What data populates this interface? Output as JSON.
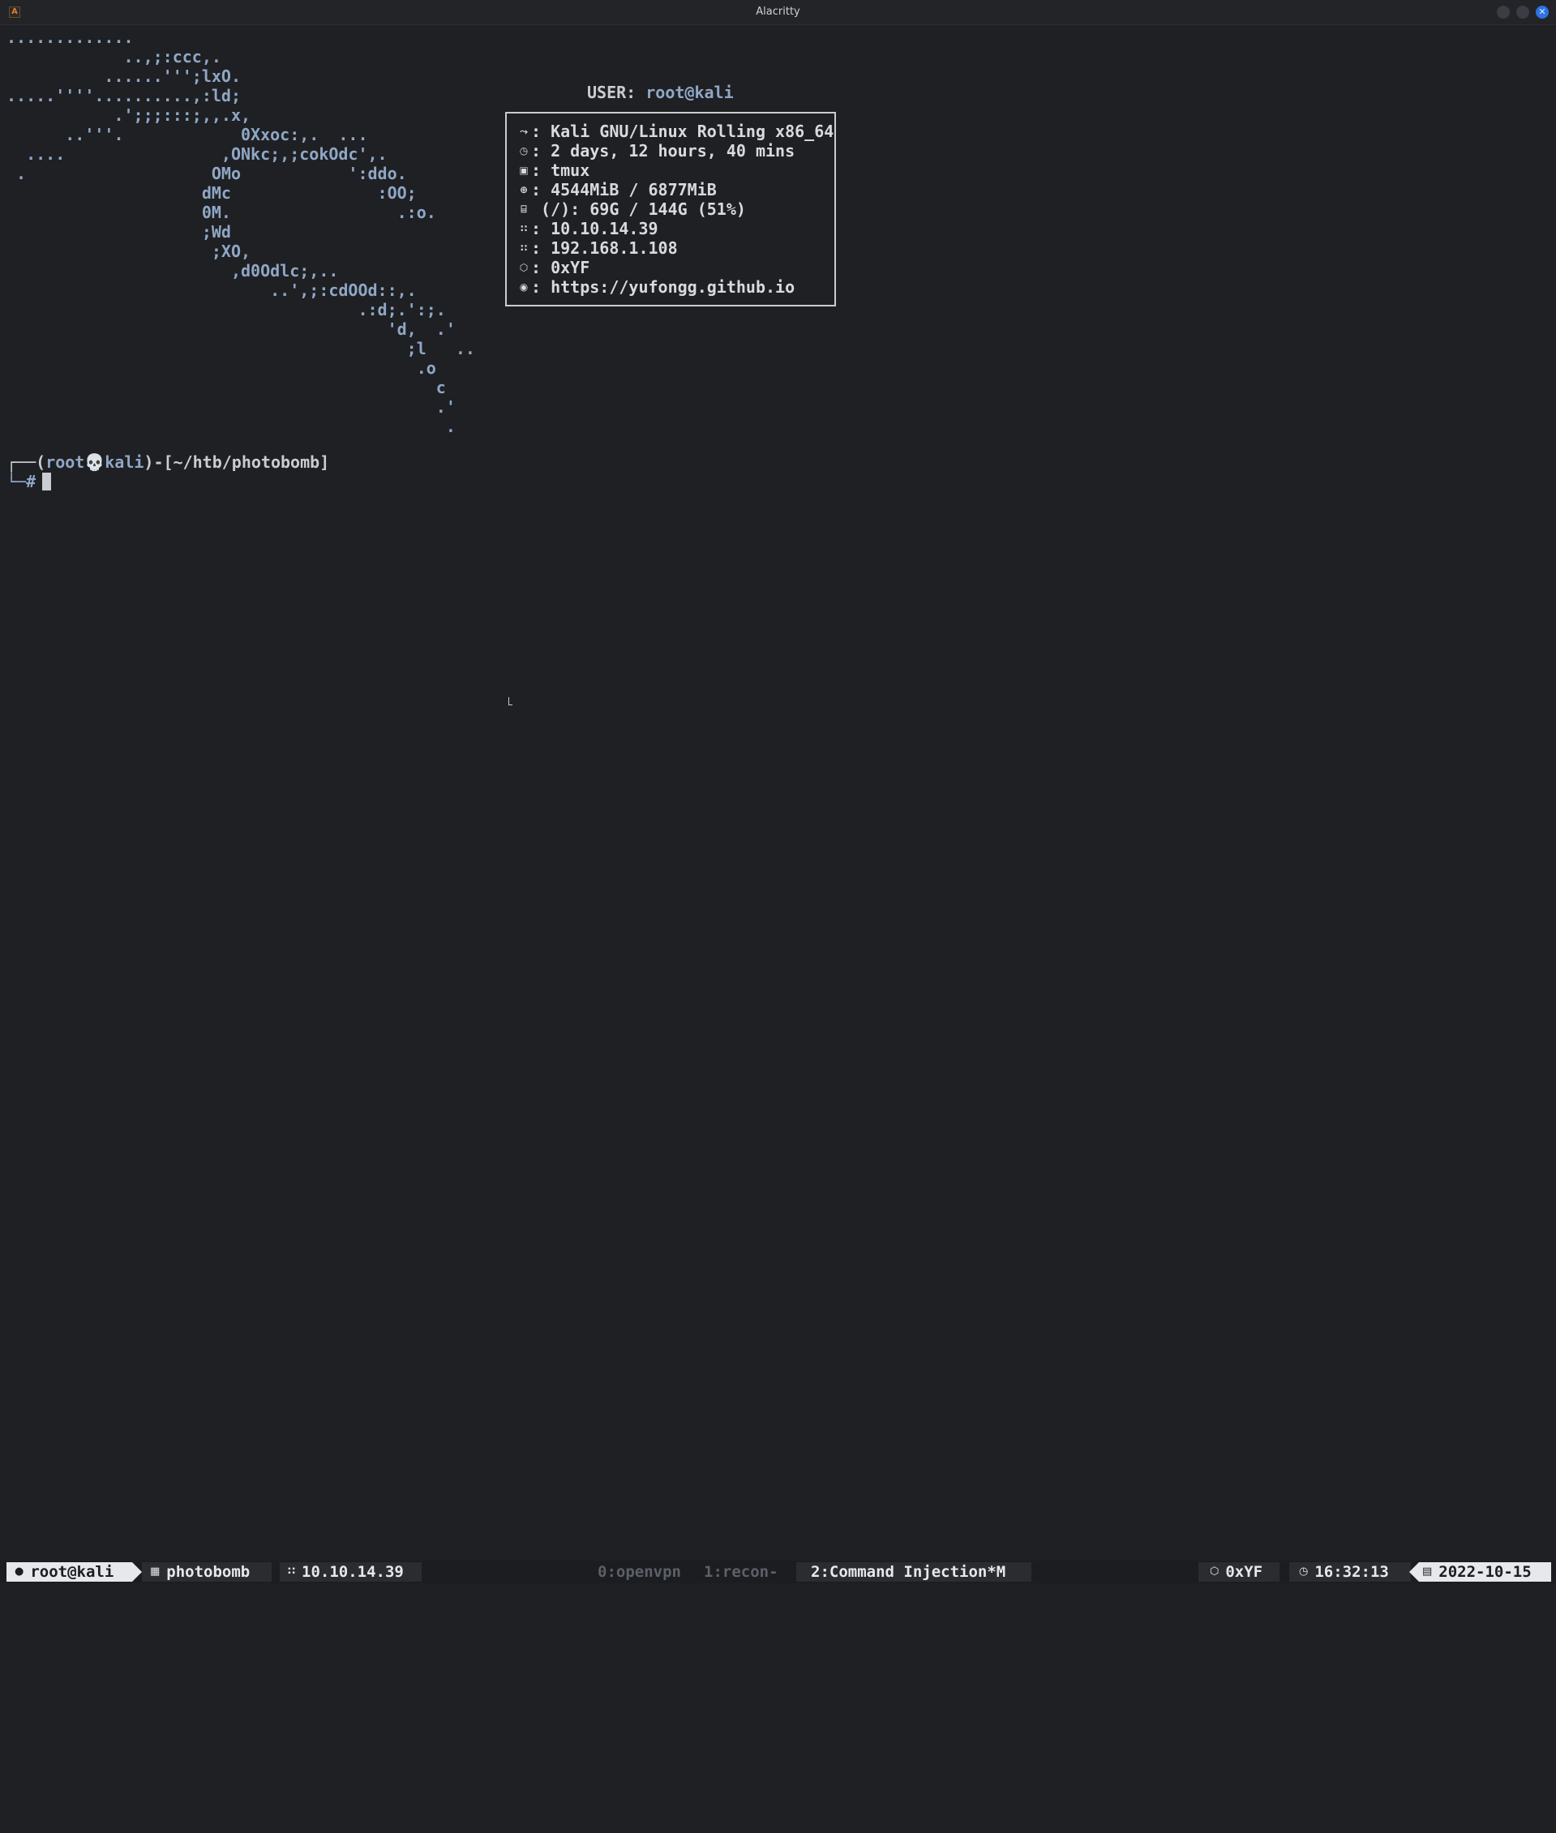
{
  "window": {
    "title": "Alacritty",
    "app_icon_glyph": "A",
    "close_glyph": "✕"
  },
  "neofetch": {
    "ascii_art": [
      ".............",
      "            ..,;:ccc,.",
      "          ......''';lxO.",
      ".....''''..........,:ld;",
      "           .';;;:::;,,.x,",
      "      ..'''.            0Xxoc:,.  ...",
      "  ....                ,ONkc;,;cokOdc',.",
      " .                   OMo           ':ddo.",
      "                    dMc               :OO;",
      "                    0M.                 .:o.",
      "                    ;Wd",
      "                     ;XO,",
      "                       ,d0Odlc;,..",
      "                           ..',;:cdOOd::,.",
      "                                    .:d;.':;.",
      "                                       'd,  .'",
      "                                         ;l   ..",
      "                                          .o",
      "                                            c",
      "                                            .'",
      "                                             ."
    ],
    "user_label": "USER: ",
    "user_value": "root@kali",
    "rows": [
      {
        "icon": "kali-dragon-icon",
        "glyph": "⤳",
        "text": ": Kali GNU/Linux Rolling x86_64"
      },
      {
        "icon": "clock-icon",
        "glyph": "◷",
        "text": ": 2 days, 12 hours, 40 mins"
      },
      {
        "icon": "terminal-icon",
        "glyph": "▣",
        "text": ": tmux"
      },
      {
        "icon": "memory-icon",
        "glyph": "⊕",
        "text": ": 4544MiB / 6877MiB"
      },
      {
        "icon": "disk-icon",
        "glyph": "⌸",
        "text": " (/): 69G / 144G (51%)"
      },
      {
        "icon": "wifi-icon",
        "glyph": "∷",
        "text": ": 10.10.14.39"
      },
      {
        "icon": "wifi-icon",
        "glyph": "∷",
        "text": ": 192.168.1.108"
      },
      {
        "icon": "cube-icon",
        "glyph": "⬡",
        "text": ": 0xYF"
      },
      {
        "icon": "github-icon",
        "glyph": "◉",
        "text": ": https://yufongg.github.io"
      }
    ]
  },
  "prompt": {
    "line1_prefix": "┌──(",
    "user": "root",
    "skull": "💀",
    "host": "kali",
    "line1_suffix": ")-[~/htb/photobomb]",
    "line2": "└─#"
  },
  "statusbar": {
    "user": "root@kali",
    "session": "photobomb",
    "ip": "10.10.14.39",
    "windows": [
      "0:openvpn",
      "1:recon-",
      "2:Command Injection*M"
    ],
    "alias": "0xYF",
    "time": "16:32:13",
    "date": "2022-10-15"
  },
  "colors": {
    "background": "#1f2023",
    "accent_blue": "#8fa7c6",
    "text": "#c9cdd2"
  }
}
